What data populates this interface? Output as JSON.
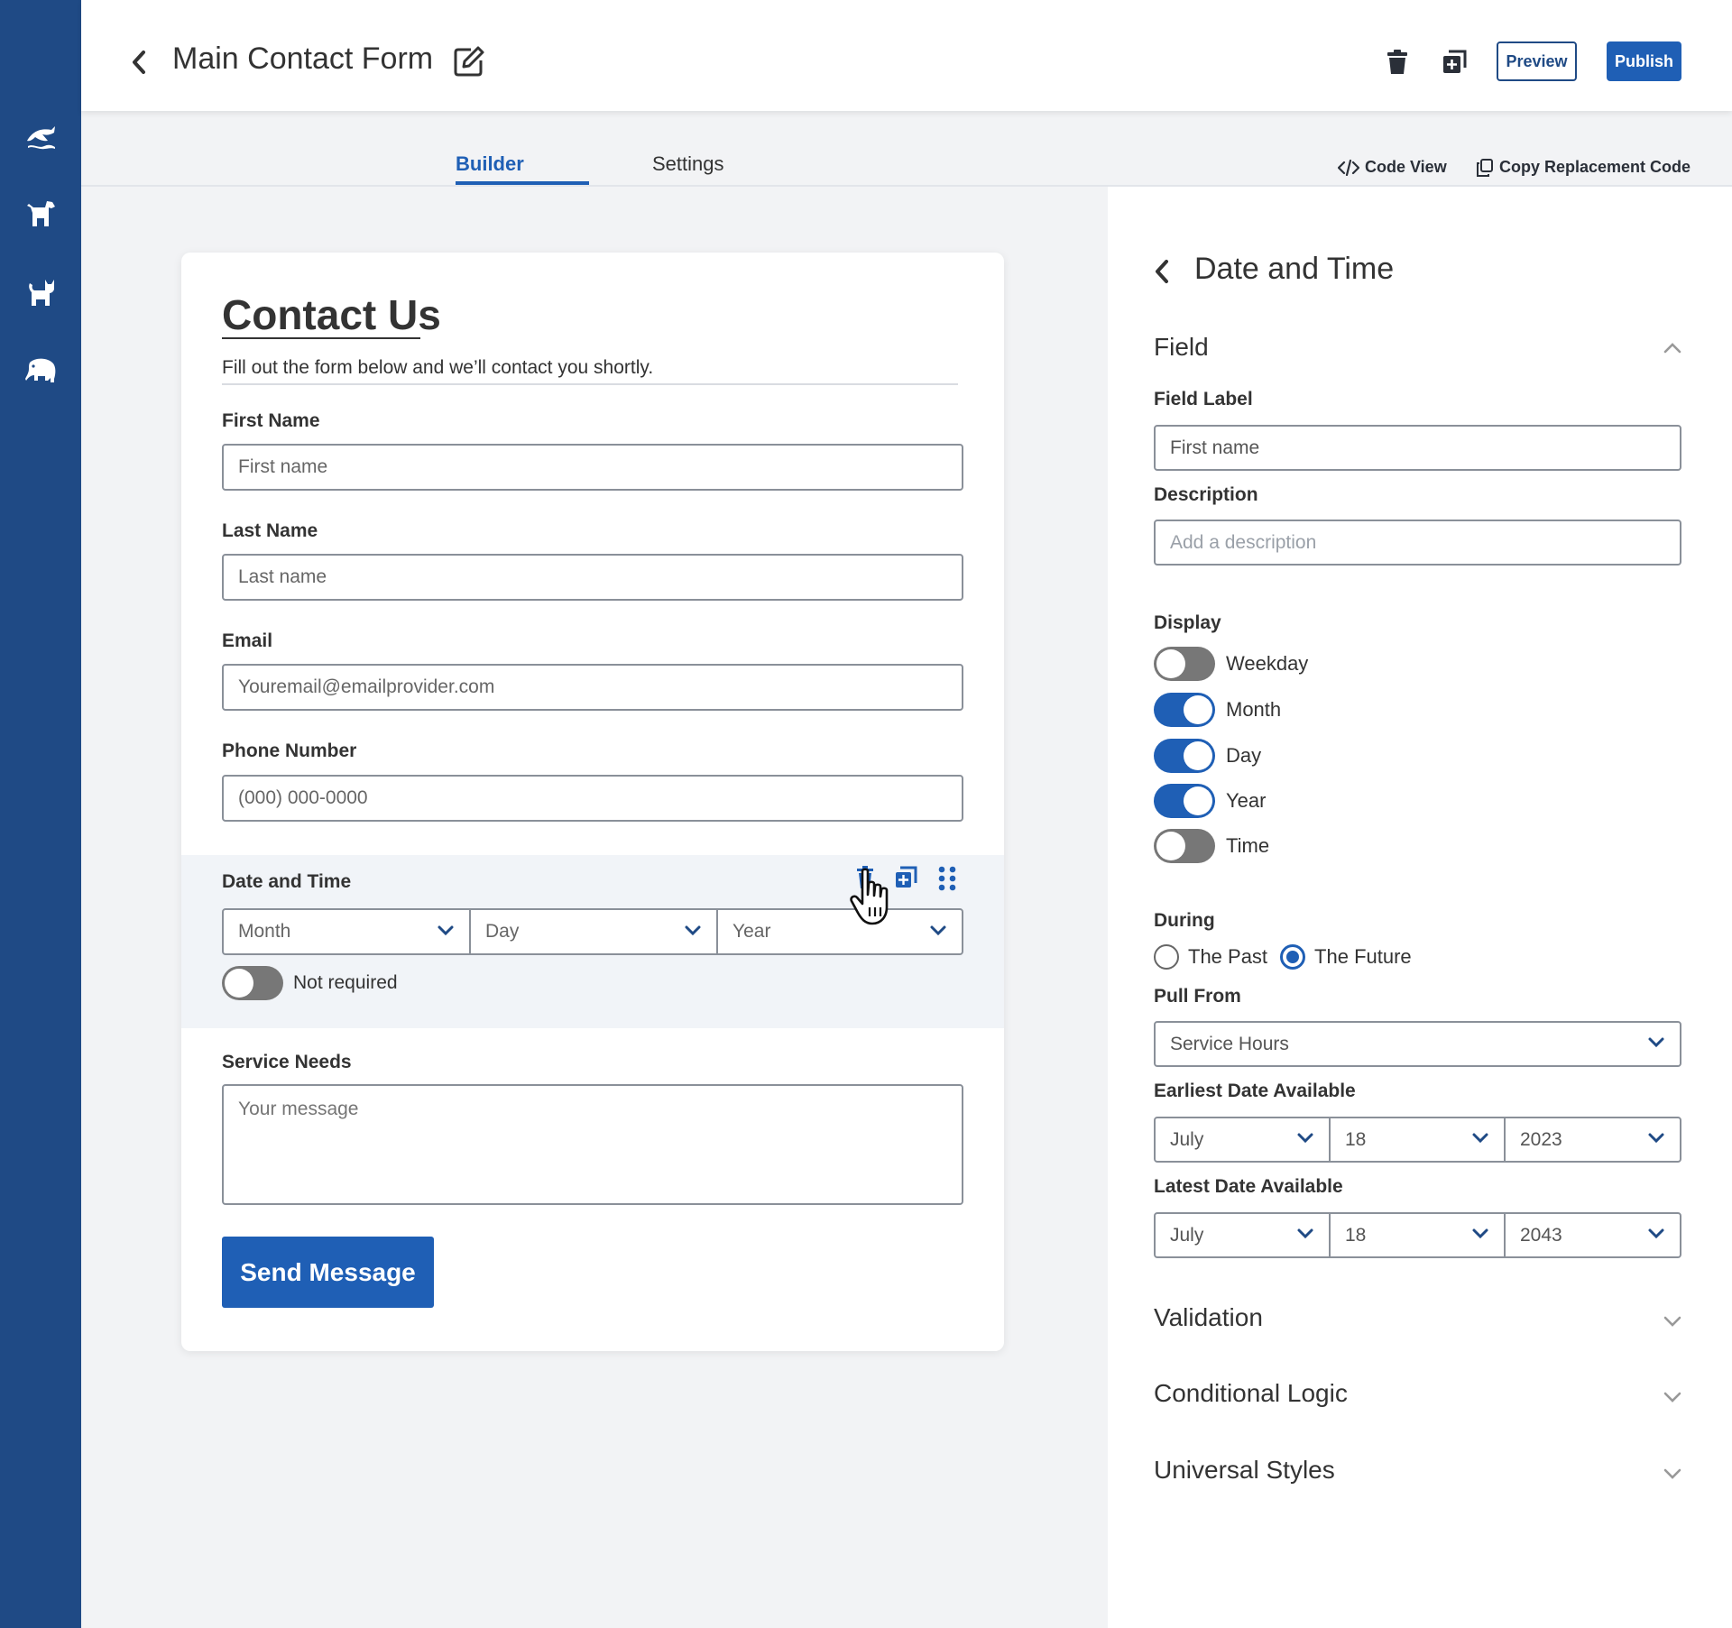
{
  "header": {
    "title": "Main Contact Form",
    "preview_label": "Preview",
    "publish_label": "Publish"
  },
  "tabs": {
    "builder": "Builder",
    "settings": "Settings",
    "active": "Builder"
  },
  "tools": {
    "code_view": "Code View",
    "copy_code": "Copy Replacement Code"
  },
  "sidebar": {
    "icons": [
      "dolphin-icon",
      "dog-icon",
      "cat-icon",
      "elephant-icon"
    ]
  },
  "form": {
    "title": "Contact Us",
    "subtitle": "Fill out the form below and we’ll contact you shortly.",
    "first_name": {
      "label": "First Name",
      "placeholder": "First name"
    },
    "last_name": {
      "label": "Last Name",
      "placeholder": "Last name"
    },
    "email": {
      "label": "Email",
      "placeholder": "Youremail@emailprovider.com"
    },
    "phone": {
      "label": "Phone Number",
      "placeholder": "(000) 000-0000"
    },
    "date_time": {
      "label": "Date and Time",
      "month": "Month",
      "day": "Day",
      "year": "Year",
      "required_label": "Not required",
      "required": false
    },
    "service": {
      "label": "Service Needs",
      "placeholder": "Your message"
    },
    "submit_label": "Send Message"
  },
  "panel": {
    "title": "Date and Time",
    "field_section": "Field",
    "field_label_label": "Field Label",
    "field_label_value": "First name",
    "description_label": "Description",
    "description_placeholder": "Add a description",
    "display_label": "Display",
    "display": [
      {
        "label": "Weekday",
        "on": false
      },
      {
        "label": "Month",
        "on": true
      },
      {
        "label": "Day",
        "on": true
      },
      {
        "label": "Year",
        "on": true
      },
      {
        "label": "Time",
        "on": false
      }
    ],
    "during_label": "During",
    "during_options": [
      "The Past",
      "The Future"
    ],
    "during_selected": "The Future",
    "pull_from_label": "Pull From",
    "pull_from_value": "Service Hours",
    "earliest_label": "Earliest Date Available",
    "earliest": {
      "month": "July",
      "day": "18",
      "year": "2023"
    },
    "latest_label": "Latest Date Available",
    "latest": {
      "month": "July",
      "day": "18",
      "year": "2043"
    },
    "validation": "Validation",
    "conditional": "Conditional Logic",
    "universal": "Universal Styles"
  },
  "colors": {
    "sidebar": "#1f4a85",
    "accent": "#1f5fb5",
    "panel_bg": "#ffffff",
    "canvas_bg": "#f2f3f5"
  }
}
